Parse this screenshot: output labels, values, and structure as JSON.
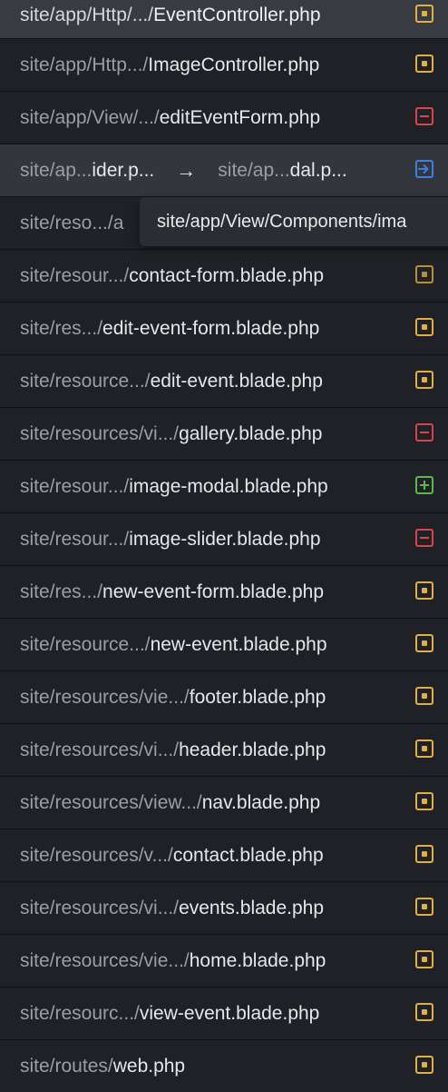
{
  "files": [
    {
      "dir": "site/app/Http/.../",
      "file": "EventController.php",
      "status": "modified"
    },
    {
      "dir": "site/app/Http.../",
      "file": "ImageController.php",
      "status": "modified"
    },
    {
      "dir": "site/app/View/.../",
      "file": "editEventForm.php",
      "status": "deleted"
    },
    {
      "dir": "site/ap...",
      "file": "ider.p...",
      "arrow": "→",
      "dir2": "site/ap...",
      "file2": "dal.p...",
      "status": "renamed"
    },
    {
      "dir": "site/reso.../",
      "file": "a",
      "status": "none"
    },
    {
      "dir": "site/resour.../",
      "file": "contact-form.blade.php",
      "status": "modified-dim"
    },
    {
      "dir": "site/res.../",
      "file": "edit-event-form.blade.php",
      "status": "modified"
    },
    {
      "dir": "site/resource.../",
      "file": "edit-event.blade.php",
      "status": "modified"
    },
    {
      "dir": "site/resources/vi.../",
      "file": "gallery.blade.php",
      "status": "deleted"
    },
    {
      "dir": "site/resour.../",
      "file": "image-modal.blade.php",
      "status": "added"
    },
    {
      "dir": "site/resour.../",
      "file": "image-slider.blade.php",
      "status": "deleted"
    },
    {
      "dir": "site/res.../",
      "file": "new-event-form.blade.php",
      "status": "modified"
    },
    {
      "dir": "site/resource.../",
      "file": "new-event.blade.php",
      "status": "modified"
    },
    {
      "dir": "site/resources/vie.../",
      "file": "footer.blade.php",
      "status": "modified"
    },
    {
      "dir": "site/resources/vi.../",
      "file": "header.blade.php",
      "status": "modified"
    },
    {
      "dir": "site/resources/view.../",
      "file": "nav.blade.php",
      "status": "modified"
    },
    {
      "dir": "site/resources/v.../",
      "file": "contact.blade.php",
      "status": "modified"
    },
    {
      "dir": "site/resources/vi.../",
      "file": "events.blade.php",
      "status": "modified"
    },
    {
      "dir": "site/resources/vie.../",
      "file": "home.blade.php",
      "status": "modified"
    },
    {
      "dir": "site/resourc.../",
      "file": "view-event.blade.php",
      "status": "modified"
    },
    {
      "dir": "site/routes/",
      "file": "web.php",
      "status": "modified"
    }
  ],
  "tooltip": {
    "text": "site/app/View/Components/ima"
  },
  "colors": {
    "modified": "#e0b043",
    "deleted": "#d9434a",
    "added": "#5cb84a",
    "renamed": "#3b7fe0",
    "background": "#1f2126"
  }
}
